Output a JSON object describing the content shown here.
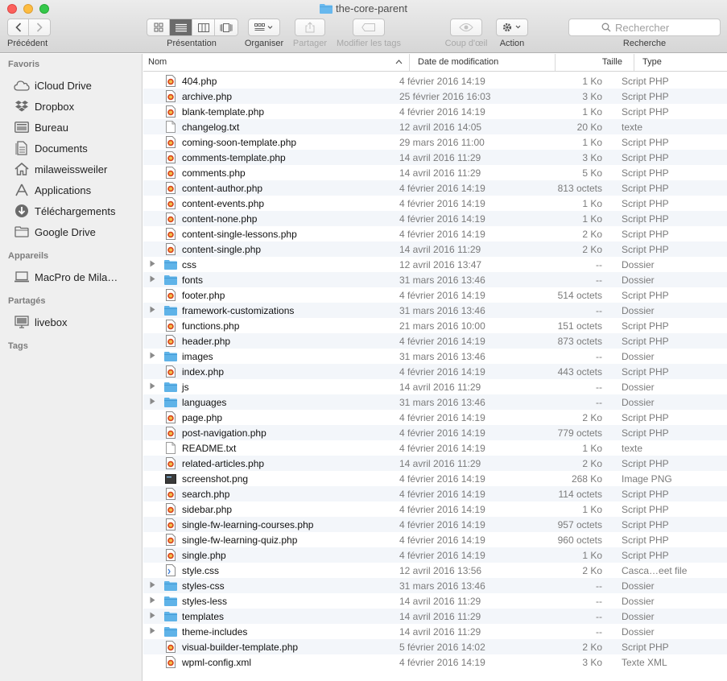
{
  "window": {
    "title": "the-core-parent"
  },
  "toolbar": {
    "back_label": "Précédent",
    "view_label": "Présentation",
    "arrange_label": "Organiser",
    "share_label": "Partager",
    "tags_label": "Modifier les tags",
    "quicklook_label": "Coup d'œil",
    "action_label": "Action",
    "search_label": "Recherche",
    "search_placeholder": "Rechercher"
  },
  "sidebar": {
    "favorites_title": "Favoris",
    "favorites": [
      {
        "label": "iCloud Drive",
        "icon": "cloud-icon"
      },
      {
        "label": "Dropbox",
        "icon": "dropbox-icon"
      },
      {
        "label": "Bureau",
        "icon": "desktop-icon"
      },
      {
        "label": "Documents",
        "icon": "documents-icon"
      },
      {
        "label": "milaweissweiler",
        "icon": "home-icon"
      },
      {
        "label": "Applications",
        "icon": "applications-icon"
      },
      {
        "label": "Téléchargements",
        "icon": "downloads-icon"
      },
      {
        "label": "Google Drive",
        "icon": "folder-icon"
      }
    ],
    "devices_title": "Appareils",
    "devices": [
      {
        "label": "MacPro de Mila…",
        "icon": "computer-icon"
      }
    ],
    "shared_title": "Partagés",
    "shared": [
      {
        "label": "livebox",
        "icon": "monitor-icon"
      }
    ],
    "tags_title": "Tags"
  },
  "columns": {
    "name": "Nom",
    "date": "Date de modification",
    "size": "Taille",
    "type": "Type"
  },
  "files": [
    {
      "name": "404.php",
      "date": "4 février 2016 14:19",
      "size": "1 Ko",
      "type": "Script PHP",
      "kind": "php"
    },
    {
      "name": "archive.php",
      "date": "25 février 2016 16:03",
      "size": "3 Ko",
      "type": "Script PHP",
      "kind": "php"
    },
    {
      "name": "blank-template.php",
      "date": "4 février 2016 14:19",
      "size": "1 Ko",
      "type": "Script PHP",
      "kind": "php"
    },
    {
      "name": "changelog.txt",
      "date": "12 avril 2016 14:05",
      "size": "20 Ko",
      "type": "texte",
      "kind": "txt"
    },
    {
      "name": "coming-soon-template.php",
      "date": "29 mars 2016 11:00",
      "size": "1 Ko",
      "type": "Script PHP",
      "kind": "php"
    },
    {
      "name": "comments-template.php",
      "date": "14 avril 2016 11:29",
      "size": "3 Ko",
      "type": "Script PHP",
      "kind": "php"
    },
    {
      "name": "comments.php",
      "date": "14 avril 2016 11:29",
      "size": "5 Ko",
      "type": "Script PHP",
      "kind": "php"
    },
    {
      "name": "content-author.php",
      "date": "4 février 2016 14:19",
      "size": "813 octets",
      "type": "Script PHP",
      "kind": "php"
    },
    {
      "name": "content-events.php",
      "date": "4 février 2016 14:19",
      "size": "1 Ko",
      "type": "Script PHP",
      "kind": "php"
    },
    {
      "name": "content-none.php",
      "date": "4 février 2016 14:19",
      "size": "1 Ko",
      "type": "Script PHP",
      "kind": "php"
    },
    {
      "name": "content-single-lessons.php",
      "date": "4 février 2016 14:19",
      "size": "2 Ko",
      "type": "Script PHP",
      "kind": "php"
    },
    {
      "name": "content-single.php",
      "date": "14 avril 2016 11:29",
      "size": "2 Ko",
      "type": "Script PHP",
      "kind": "php"
    },
    {
      "name": "css",
      "date": "12 avril 2016 13:47",
      "size": "--",
      "type": "Dossier",
      "kind": "folder"
    },
    {
      "name": "fonts",
      "date": "31 mars 2016 13:46",
      "size": "--",
      "type": "Dossier",
      "kind": "folder"
    },
    {
      "name": "footer.php",
      "date": "4 février 2016 14:19",
      "size": "514 octets",
      "type": "Script PHP",
      "kind": "php"
    },
    {
      "name": "framework-customizations",
      "date": "31 mars 2016 13:46",
      "size": "--",
      "type": "Dossier",
      "kind": "folder"
    },
    {
      "name": "functions.php",
      "date": "21 mars 2016 10:00",
      "size": "151 octets",
      "type": "Script PHP",
      "kind": "php"
    },
    {
      "name": "header.php",
      "date": "4 février 2016 14:19",
      "size": "873 octets",
      "type": "Script PHP",
      "kind": "php"
    },
    {
      "name": "images",
      "date": "31 mars 2016 13:46",
      "size": "--",
      "type": "Dossier",
      "kind": "folder"
    },
    {
      "name": "index.php",
      "date": "4 février 2016 14:19",
      "size": "443 octets",
      "type": "Script PHP",
      "kind": "php"
    },
    {
      "name": "js",
      "date": "14 avril 2016 11:29",
      "size": "--",
      "type": "Dossier",
      "kind": "folder"
    },
    {
      "name": "languages",
      "date": "31 mars 2016 13:46",
      "size": "--",
      "type": "Dossier",
      "kind": "folder"
    },
    {
      "name": "page.php",
      "date": "4 février 2016 14:19",
      "size": "2 Ko",
      "type": "Script PHP",
      "kind": "php"
    },
    {
      "name": "post-navigation.php",
      "date": "4 février 2016 14:19",
      "size": "779 octets",
      "type": "Script PHP",
      "kind": "php"
    },
    {
      "name": "README.txt",
      "date": "4 février 2016 14:19",
      "size": "1 Ko",
      "type": "texte",
      "kind": "txt"
    },
    {
      "name": "related-articles.php",
      "date": "14 avril 2016 11:29",
      "size": "2 Ko",
      "type": "Script PHP",
      "kind": "php"
    },
    {
      "name": "screenshot.png",
      "date": "4 février 2016 14:19",
      "size": "268 Ko",
      "type": "Image PNG",
      "kind": "png"
    },
    {
      "name": "search.php",
      "date": "4 février 2016 14:19",
      "size": "114 octets",
      "type": "Script PHP",
      "kind": "php"
    },
    {
      "name": "sidebar.php",
      "date": "4 février 2016 14:19",
      "size": "1 Ko",
      "type": "Script PHP",
      "kind": "php"
    },
    {
      "name": "single-fw-learning-courses.php",
      "date": "4 février 2016 14:19",
      "size": "957 octets",
      "type": "Script PHP",
      "kind": "php"
    },
    {
      "name": "single-fw-learning-quiz.php",
      "date": "4 février 2016 14:19",
      "size": "960 octets",
      "type": "Script PHP",
      "kind": "php"
    },
    {
      "name": "single.php",
      "date": "4 février 2016 14:19",
      "size": "1 Ko",
      "type": "Script PHP",
      "kind": "php"
    },
    {
      "name": "style.css",
      "date": "12 avril 2016 13:56",
      "size": "2 Ko",
      "type": "Casca…eet file",
      "kind": "css"
    },
    {
      "name": "styles-css",
      "date": "31 mars 2016 13:46",
      "size": "--",
      "type": "Dossier",
      "kind": "folder"
    },
    {
      "name": "styles-less",
      "date": "14 avril 2016 11:29",
      "size": "--",
      "type": "Dossier",
      "kind": "folder"
    },
    {
      "name": "templates",
      "date": "14 avril 2016 11:29",
      "size": "--",
      "type": "Dossier",
      "kind": "folder"
    },
    {
      "name": "theme-includes",
      "date": "14 avril 2016 11:29",
      "size": "--",
      "type": "Dossier",
      "kind": "folder"
    },
    {
      "name": "visual-builder-template.php",
      "date": "5 février 2016 14:02",
      "size": "2 Ko",
      "type": "Script PHP",
      "kind": "php"
    },
    {
      "name": "wpml-config.xml",
      "date": "4 février 2016 14:19",
      "size": "3 Ko",
      "type": "Texte XML",
      "kind": "php"
    }
  ],
  "colors": {
    "folder": "#5fb3e8",
    "sidebar_bg": "#efefef",
    "row_alt": "#f3f6fa",
    "php_icon": "#d8461f"
  }
}
